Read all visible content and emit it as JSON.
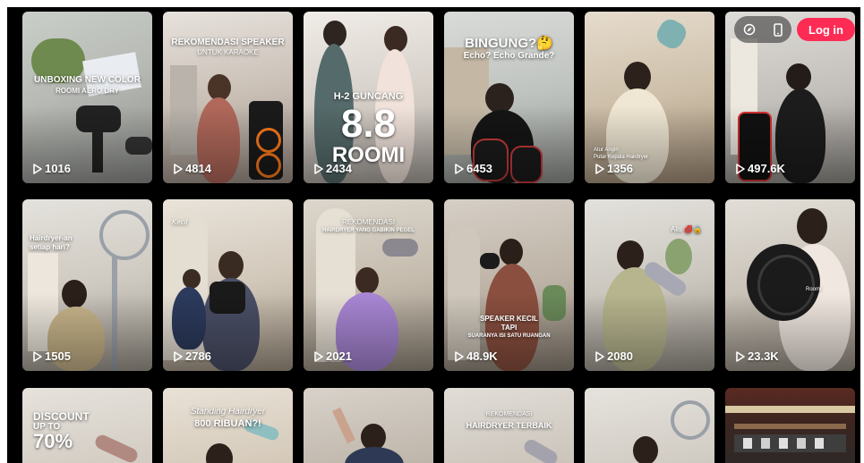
{
  "header": {
    "login_label": "Log in"
  },
  "videos": [
    {
      "views": "1016",
      "overlay": [
        "UNBOXING NEW COLOR",
        "ROOMI AERO DRY"
      ]
    },
    {
      "views": "4814",
      "overlay": [
        "REKOMENDASI SPEAKER",
        "UNTUK KARAOKE"
      ]
    },
    {
      "views": "2434",
      "overlay": [
        "H-2 GUNCANG",
        "8.8",
        "ROOMI"
      ]
    },
    {
      "views": "6453",
      "overlay": [
        "BINGUNG?🤔",
        "Echo? Echo Grande?"
      ]
    },
    {
      "views": "1356",
      "overlay": [
        "Atur Angin",
        "Putar Kepala Hairdryer"
      ]
    },
    {
      "views": "497.6K",
      "overlay": []
    },
    {
      "views": "1505",
      "overlay": [
        "Hairdryer-an",
        "setiap hari?"
      ]
    },
    {
      "views": "2786",
      "overlay": [
        "Kecil"
      ]
    },
    {
      "views": "2021",
      "overlay": [
        "REKOMENDASI",
        "HAIRDRYER YANG GABIKIN PEGEL"
      ]
    },
    {
      "views": "48.9K",
      "overlay": [
        "SPEAKER KECIL",
        "TAPI",
        "SUARANYA ISI SATU RUANGAN"
      ]
    },
    {
      "views": "2080",
      "overlay": [
        "Alis 💋🔒"
      ]
    },
    {
      "views": "23.3K",
      "overlay": [
        "Roomi"
      ]
    },
    {
      "views": "",
      "overlay": [
        "DISCOUNT",
        "UP TO",
        "70%"
      ]
    },
    {
      "views": "",
      "overlay": [
        "Standing Hairdryer",
        "800 RIBUAN?!"
      ]
    },
    {
      "views": "",
      "overlay": []
    },
    {
      "views": "",
      "overlay": [
        "REKOMENDASI",
        "HAIRDRYER TERBAIK"
      ]
    },
    {
      "views": "",
      "overlay": []
    },
    {
      "views": "",
      "overlay": []
    }
  ]
}
